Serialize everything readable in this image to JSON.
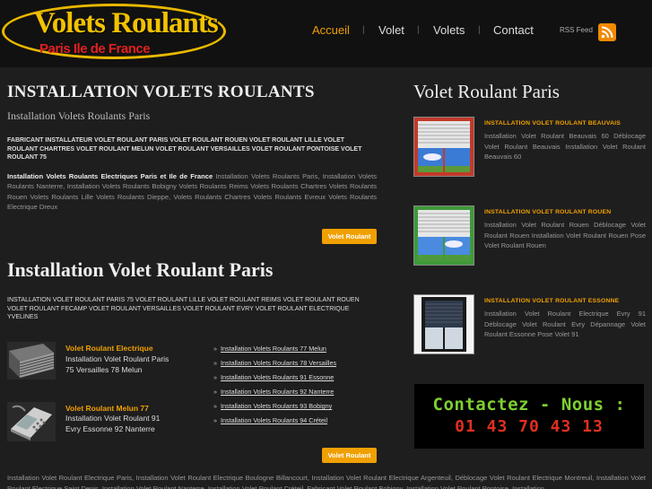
{
  "header": {
    "logo_title": "Volets Roulants",
    "logo_subtitle": "Paris Ile de France",
    "nav": [
      {
        "label": "Accueil",
        "active": true
      },
      {
        "label": "Volet",
        "active": false
      },
      {
        "label": "Volets",
        "active": false
      },
      {
        "label": "Contact",
        "active": false
      }
    ],
    "rss_label": "RSS Feed",
    "rss_icon": "rss-icon"
  },
  "main": {
    "title": "INSTALLATION VOLETS ROULANTS",
    "subtitle": "Installation Volets Roulants Paris",
    "caps_text": "FABRICANT INSTALLATEUR VOLET ROULANT PARIS VOLET ROULANT ROUEN VOLET ROULANT LILLE VOLET ROULANT CHARTRES VOLET ROULANT MELUN VOLET ROULANT VERSAILLES VOLET ROULANT PONTOISE VOLET ROULANT 75",
    "para_bold": "Installation Volets Roulants Electriques Paris et Ile de France",
    "para_text": " Installation Volets Roulants Paris, Installation Volets Roulants Nanterre, Installation Volets Roulants Bobigny Volets Roulants Reims Volets Roulants Chartres Volets Roulants Rouen Volets Roulants Lille Volets Roulants Dieppe, Volets Roulants Chartres Volets Roulants Evreux Volets Roulants Electrique Dreux",
    "button1": "Volet Roulant",
    "title2": "Installation Volet Roulant Paris",
    "caps_text2": "INSTALLATION VOLET ROULANT PARIS 75 VOLET ROULANT LILLE VOLET ROULANT REIMS VOLET ROULANT ROUEN VOLET ROULANT FECAMP VOLET ROULANT VERSAILLES VOLET ROULANT EVRY VOLET ROULANT ELECTRIQUE YVELINES",
    "products": [
      {
        "title": "Volet Roulant Electrique",
        "line1": "Installation Volet Roulant Paris",
        "line2": "75 Versailles 78 Melun"
      },
      {
        "title": "Volet Roulant Melun 77",
        "line1": "Installation  Volet  Roulant  91",
        "line2": "Evry Essonne 92 Nanterre"
      }
    ],
    "links": [
      "Installation Volets Roulants 77 Melun",
      "Installation Volets Roulants 78 Versailles",
      "Installation Volets Roulants 91 Essonne",
      "Installation Volets Roulants 92 Nanterre",
      "Installation Volets Roulants 93 Bobigny",
      "Installation Volets Roulants 94 Créteil"
    ],
    "bullet": "»",
    "button2": "Volet Roulant"
  },
  "sidebar": {
    "title": "Volet Roulant Paris",
    "items": [
      {
        "heading": "INSTALLATION VOLET ROULANT BEAUVAIS",
        "text": "Installation Volet Roulant Beauvais 60 Déblocage Volet Roulant Beauvais Installation Volet Roulant Beauvais 60"
      },
      {
        "heading": "INSTALLATION VOLET ROULANT ROUEN",
        "text": "Installation Volet Roulant Rouen Déblocage Volet Roulant Rouen Installation Volet Roulant Rouen Pose Volet Roulant Rouen"
      },
      {
        "heading": "INSTALLATION VOLET ROULANT ESSONNE",
        "text": "Installation Volet Roulant Electrique Evry 91 Déblocage Volet Roulant Evry Dépannage Volet Roulant Essonne Pose Volet 91"
      }
    ],
    "contact_line1": "Contactez - Nous :",
    "contact_line2": "01 43 70 43 13"
  },
  "footer": {
    "text": "Installation Volet Roulant Electrique Paris, Installation Volet Roulant Electrique Boulogne Billancourt, Installation Volet Roulant Electrique Argenteuil, Déblocage Volet Roulant Electrique Montreuil, Installation Volet Roulant Electrique Saint Denis, Installation Volet Roulant Nanterre, Installation Volet Roulant Créteil, Fabricant Volet Roulant Bobigny, Installation Volet Roulant Pontoise, Installation"
  },
  "colors": {
    "accent": "#f0a000",
    "background": "#1e1e1e",
    "header": "#111111",
    "logo_gold": "#f2c200",
    "logo_red": "#e02020"
  }
}
